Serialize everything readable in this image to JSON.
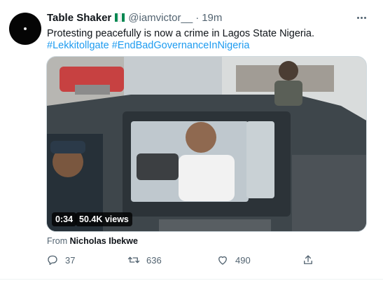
{
  "tweet": {
    "display_name": "Table Shaker",
    "handle": "@iamvictor__",
    "separator": "·",
    "time": "19m",
    "text": "Protesting peacefully is now a crime in Lagos State Nigeria.",
    "hashtags": [
      "#Lekkitollgate",
      "#EndBadGovernanceInNigeria"
    ],
    "flag_colors": [
      "#008751",
      "#ffffff",
      "#008751"
    ],
    "media": {
      "duration": "0:34",
      "views": "50.4K views"
    },
    "attribution": {
      "prefix": "From",
      "name": "Nicholas Ibekwe"
    },
    "actions": {
      "reply_count": "37",
      "retweet_count": "636",
      "like_count": "490",
      "icons": [
        "reply-icon",
        "retweet-icon",
        "like-icon",
        "share-icon"
      ]
    },
    "colors": {
      "link": "#1d9bf0",
      "muted": "#536471",
      "text": "#0f1419"
    }
  }
}
